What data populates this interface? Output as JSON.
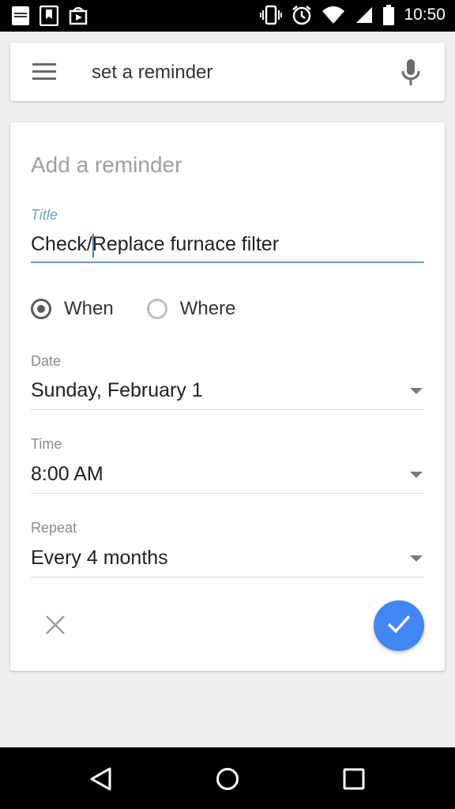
{
  "status_bar": {
    "time": "10:50",
    "left_icons": [
      "bible-app-icon",
      "bookmark-app-icon",
      "play-store-icon"
    ],
    "right_icons": [
      "vibrate-icon",
      "alarm-icon",
      "wifi-icon",
      "cell-signal-icon",
      "battery-icon"
    ]
  },
  "search": {
    "query": "set a reminder",
    "icons": [
      "menu-icon",
      "microphone-icon"
    ]
  },
  "reminder": {
    "heading": "Add a reminder",
    "title_label": "Title",
    "title_value": "Check/Replace furnace filter",
    "trigger": {
      "selected": "When",
      "options": [
        "When",
        "Where"
      ]
    },
    "date": {
      "label": "Date",
      "value": "Sunday, February 1"
    },
    "time": {
      "label": "Time",
      "value": "8:00 AM"
    },
    "repeat": {
      "label": "Repeat",
      "value": "Every 4 months"
    },
    "actions": [
      "cancel-icon",
      "checkmark-icon"
    ]
  },
  "colors": {
    "accent": "#4285f4",
    "focus_underline": "#6a9be0",
    "background": "#efefef"
  }
}
